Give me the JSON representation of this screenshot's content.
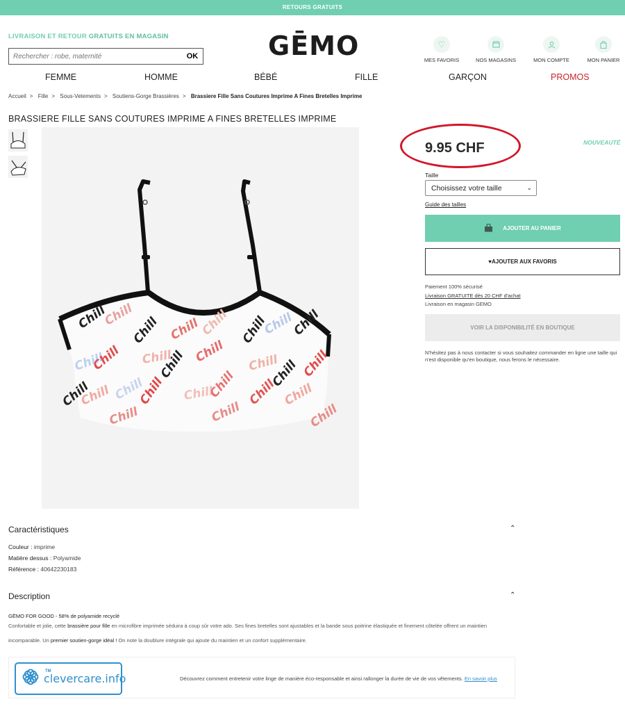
{
  "top_banner": "RETOURS GRATUITS",
  "header": {
    "promo_prefix": "LIVRAISON ET RETOUR",
    "promo_strong": "GRATUITS EN MAGASIN",
    "search_placeholder": "Rechercher : robe, maternité",
    "search_button": "OK",
    "logo": "GĒMO",
    "utilities": [
      {
        "label": "MES FAVORIS",
        "icon": "heart-icon"
      },
      {
        "label": "NOS MAGASINS",
        "icon": "store-icon"
      },
      {
        "label": "MON COMPTE",
        "icon": "user-icon"
      },
      {
        "label": "MON PANIER",
        "icon": "bag-icon"
      }
    ]
  },
  "nav": [
    "FEMME",
    "HOMME",
    "BÉBÉ",
    "FILLE",
    "GARÇON",
    "PROMOS"
  ],
  "breadcrumb": [
    "Accueil",
    "Fille",
    "Sous-Vetements",
    "Soutiens-Gorge Brassières",
    "Brassiere Fille Sans Coutures Imprime A Fines Bretelles Imprime"
  ],
  "product": {
    "title": "BRASSIERE FILLE SANS COUTURES IMPRIME A FINES BRETELLES IMPRIME",
    "price": "9.95 CHF",
    "badge": "NOUVEAUTÉ",
    "size_label": "Taille",
    "size_select": "Choisissez votre taille",
    "size_guide": "Guide des tailles",
    "add_to_cart": "AJOUTER AU PANIER",
    "add_to_fav": "AJOUTER AUX FAVORIS",
    "payment_secure": "Paiement 100% sécurisé",
    "free_delivery": "Livraison GRATUITE dès 20 CHF d'achat",
    "store_delivery": "Livraison en magasin GEMO",
    "availability": "VOIR LA DISPONIBILITÉ EN BOUTIQUE",
    "help": "N'hésitez pas à nous contacter si vous souhaitez commander en ligne une taille qui n'est disponible qu'en boutique, nous ferons le nécessaire.",
    "print_word": "Chill"
  },
  "characteristics": {
    "title": "Caractéristiques",
    "rows": [
      {
        "label": "Couleur :",
        "value": "imprime"
      },
      {
        "label": "Matière dessus :",
        "value": "Polyamide"
      },
      {
        "label": "Référence :",
        "value": "40642230183"
      }
    ]
  },
  "description": {
    "title": "Description",
    "headline": "GĒMO FOR GOOD - 58% de polyamide recyclé",
    "p1_a": "Confortable et jolie, cette",
    "p1_b": "brassière pour fille",
    "p1_c": "en microfibre imprimée séduira à coup sûr votre ado. Ses fines bretelles sont ajustables et la bande sous poitrine élastiquée et finement côtelée offrent un maintien",
    "p2_a": "incomparable. Un",
    "p2_b": "premier soutien-gorge idéal !",
    "p2_c": "On note la doublure intégrale qui ajoute du maintien et un confort supplémentaire."
  },
  "clevercare": {
    "logo_text": "clevercare.info",
    "tm": "TM",
    "text": "Découvrez comment entretenir votre linge de manière éco-responsable et ainsi rallonger la durée de vie de vos vêtements.",
    "link": "En savoir plus"
  },
  "colors": {
    "accent": "#6fcfb0",
    "promo": "#c8252c",
    "highlight_ring": "#d1172b",
    "clevercare": "#2f8fcd"
  }
}
